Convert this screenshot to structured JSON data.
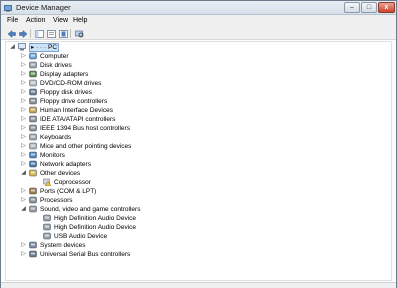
{
  "window": {
    "title": "Device Manager"
  },
  "menu": [
    "File",
    "Action",
    "View",
    "Help"
  ],
  "toolbar": {
    "buttons": [
      "back-arrow-icon",
      "forward-arrow-icon",
      "show-hide-console-tree-icon",
      "properties-icon",
      "help-icon",
      "scan-hardware-icon"
    ]
  },
  "tree": {
    "root_label": "PC",
    "items": [
      {
        "label": "Computer",
        "expander": "▷",
        "icon": "computer-icon"
      },
      {
        "label": "Disk drives",
        "expander": "▷",
        "icon": "disk-drive-icon"
      },
      {
        "label": "Display adapters",
        "expander": "▷",
        "icon": "display-adapter-icon"
      },
      {
        "label": "DVD/CD-ROM drives",
        "expander": "▷",
        "icon": "dvd-drive-icon"
      },
      {
        "label": "Floppy disk drives",
        "expander": "▷",
        "icon": "floppy-disk-icon"
      },
      {
        "label": "Floppy drive controllers",
        "expander": "▷",
        "icon": "floppy-controller-icon"
      },
      {
        "label": "Human Interface Devices",
        "expander": "▷",
        "icon": "hid-icon"
      },
      {
        "label": "IDE ATA/ATAPI controllers",
        "expander": "▷",
        "icon": "ide-controller-icon"
      },
      {
        "label": "IEEE 1394 Bus host controllers",
        "expander": "▷",
        "icon": "ieee1394-icon"
      },
      {
        "label": "Keyboards",
        "expander": "▷",
        "icon": "keyboard-icon"
      },
      {
        "label": "Mice and other pointing devices",
        "expander": "▷",
        "icon": "mouse-icon"
      },
      {
        "label": "Monitors",
        "expander": "▷",
        "icon": "monitor-icon"
      },
      {
        "label": "Network adapters",
        "expander": "▷",
        "icon": "network-adapter-icon"
      },
      {
        "label": "Other devices",
        "expander": "◢",
        "icon": "other-devices-icon"
      },
      {
        "label": "Coprocessor",
        "expander": "",
        "icon": "unknown-device-warning-icon",
        "child": true
      },
      {
        "label": "Ports (COM & LPT)",
        "expander": "▷",
        "icon": "port-icon"
      },
      {
        "label": "Processors",
        "expander": "▷",
        "icon": "processor-icon"
      },
      {
        "label": "Sound, video and game controllers",
        "expander": "◢",
        "icon": "sound-icon"
      },
      {
        "label": "High Definition Audio Device",
        "expander": "",
        "icon": "audio-device-icon",
        "child": true
      },
      {
        "label": "High Definition Audio Device",
        "expander": "",
        "icon": "audio-device-icon",
        "child": true
      },
      {
        "label": "USB Audio Device",
        "expander": "",
        "icon": "audio-device-icon",
        "child": true
      },
      {
        "label": "System devices",
        "expander": "▷",
        "icon": "system-devices-icon"
      },
      {
        "label": "Universal Serial Bus controllers",
        "expander": "▷",
        "icon": "usb-icon"
      }
    ]
  }
}
